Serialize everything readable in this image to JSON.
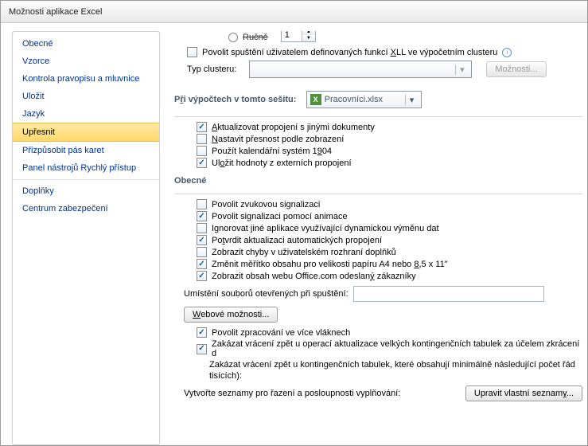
{
  "title": "Možnosti aplikace Excel",
  "sidebar": {
    "items": [
      {
        "label": "Obecné"
      },
      {
        "label": "Vzorce"
      },
      {
        "label": "Kontrola pravopisu a mluvnice"
      },
      {
        "label": "Uložit"
      },
      {
        "label": "Jazyk"
      },
      {
        "label": "Upřesnit"
      },
      {
        "label": "Přizpůsobit pás karet"
      },
      {
        "label": "Panel nástrojů Rychlý přístup"
      },
      {
        "label": "Doplňky"
      },
      {
        "label": "Centrum zabezpečení"
      }
    ]
  },
  "top": {
    "partial_label": "Ručně",
    "spin_value": "1",
    "xll_label_pre": "Povolit spuštění uživatelem definovaných funkcí ",
    "xll_u": "X",
    "xll_label_post": "LL ve výpočetním clusteru",
    "cluster_label": "Typ clusteru:",
    "options_btn": "Možnosti..."
  },
  "section_calc": {
    "heading_pre": "P",
    "heading_u": "ř",
    "heading_post": "i výpočtech v tomto sešitu:",
    "workbook": "Pracovníci.xlsx",
    "items": [
      {
        "u": "A",
        "label": "ktualizovat propojení s jinými dokumenty",
        "on": true
      },
      {
        "u": "N",
        "label": "astavit přesnost podle zobrazení",
        "on": false
      },
      {
        "pre": "Použít kalendářní systém 1",
        "u": "9",
        "label": "04",
        "on": false
      },
      {
        "pre": "Ul",
        "u": "o",
        "label": "žit hodnoty z externích propojení",
        "on": true
      }
    ]
  },
  "section_general": {
    "heading": "Obecné",
    "items": [
      {
        "label": "Povolit zvukovou signalizaci",
        "on": false
      },
      {
        "label": "Povolit signalizaci pomocí animace",
        "on": true
      },
      {
        "label": "Ignorovat jiné aplikace využívající dynamickou výměnu dat",
        "on": false
      },
      {
        "pre": "Po",
        "u": "t",
        "label": "vrdit aktualizaci automatických propojení",
        "on": true
      },
      {
        "label": "Zobrazit chyby v uživatelském rozhraní doplňků",
        "on": false
      },
      {
        "pre": "Změnit měřítko obsahu pro velikosti papíru A4 nebo ",
        "u": "8",
        "label": ",5 x 11\"",
        "on": true
      },
      {
        "pre": "Zobrazit obsah webu Office.com odeslan",
        "u": "ý",
        "label": " zákazníky",
        "on": true
      }
    ],
    "startup_label": "Umístění souborů otevřených při spuštění:",
    "web_btn_u": "W",
    "web_btn": "ebové možnosti...",
    "threads_label": "Povolit zpracování ve více vláknech",
    "undo1": "Zakázat vrácení zpět u operací aktualizace velkých kontingenčních tabulek za účelem zkrácení d",
    "undo2": "Zakázat vrácení zpět u kontingenčních tabulek, které obsahují minimálně následující počet řád",
    "undo2b": "tisících):",
    "lists_label": "Vytvořte seznamy pro řazení a posloupnosti vyplňování:",
    "lists_btn_pre": "Upravit vlastní seznam",
    "lists_btn_u": "y",
    "lists_btn_post": "..."
  }
}
